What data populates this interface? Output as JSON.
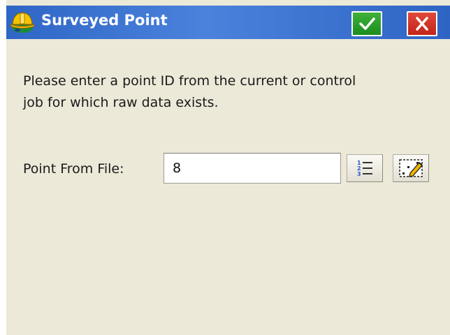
{
  "window": {
    "title": "Surveyed Point",
    "app_icon": "hard-hat-icon",
    "ok_icon": "checkmark-icon",
    "close_icon": "close-icon"
  },
  "content": {
    "message_line1": "Please enter a point ID from the current or control",
    "message_line2": "job for which raw data exists.",
    "field_label": "Point From File:",
    "field_value": "8",
    "list_button_icon": "numbered-list-icon",
    "edit_button_icon": "map-pencil-icon"
  },
  "colors": {
    "titlebar": "#3b73d4",
    "background": "#ece9d9",
    "ok": "#2a9a2a",
    "close": "#d22f22"
  }
}
